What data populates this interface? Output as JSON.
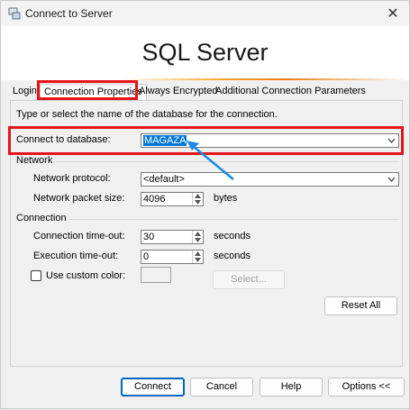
{
  "window": {
    "title": "Connect to Server",
    "close_symbol": "✕"
  },
  "banner": {
    "title": "SQL Server"
  },
  "tabs": [
    {
      "label": "Login"
    },
    {
      "label": "Connection Properties"
    },
    {
      "label": "Always Encrypted"
    },
    {
      "label": "Additional Connection Parameters"
    }
  ],
  "instructions": "Type or select the name of the database for the connection.",
  "connect_db": {
    "label": "Connect to database:",
    "value": "MAGAZA"
  },
  "network": {
    "group_label": "Network",
    "protocol_label": "Network protocol:",
    "protocol_value": "<default>",
    "packet_label": "Network packet size:",
    "packet_value": "4096",
    "packet_unit": "bytes"
  },
  "connection": {
    "group_label": "Connection",
    "timeout_label": "Connection time-out:",
    "timeout_value": "30",
    "timeout_unit": "seconds",
    "exec_label": "Execution time-out:",
    "exec_value": "0",
    "exec_unit": "seconds",
    "custom_color_label": "Use custom color:",
    "select_label": "Select..."
  },
  "buttons": {
    "reset_all": "Reset All",
    "connect": "Connect",
    "cancel": "Cancel",
    "help": "Help",
    "options": "Options <<"
  },
  "colors": {
    "highlight_box": "#e4141a",
    "selection": "#0078d7",
    "annotation_arrow": "#1e88e5",
    "default_button_border": "#0067c0"
  }
}
